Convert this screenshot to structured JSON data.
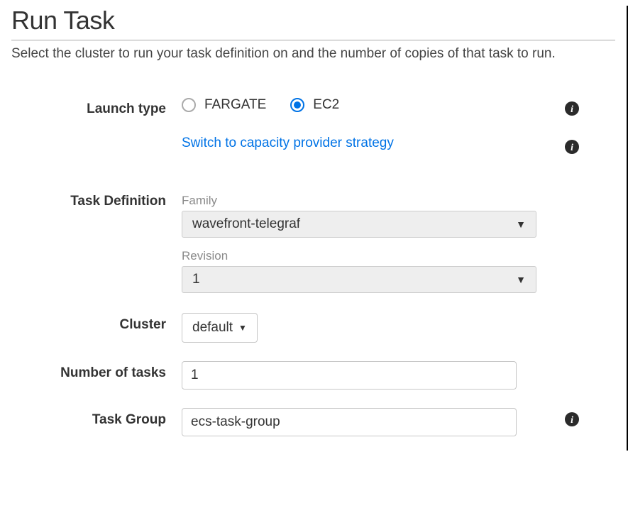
{
  "header": {
    "title": "Run Task",
    "subtitle": "Select the cluster to run your task definition on and the number of copies of that task to run."
  },
  "form": {
    "launch_type": {
      "label": "Launch type",
      "options": {
        "fargate": "FARGATE",
        "ec2": "EC2"
      },
      "selected": "EC2"
    },
    "capacity_link": "Switch to capacity provider strategy",
    "task_definition": {
      "label": "Task Definition",
      "family_label": "Family",
      "family_value": "wavefront-telegraf",
      "revision_label": "Revision",
      "revision_value": "1"
    },
    "cluster": {
      "label": "Cluster",
      "value": "default"
    },
    "number_of_tasks": {
      "label": "Number of tasks",
      "value": "1"
    },
    "task_group": {
      "label": "Task Group",
      "value": "ecs-task-group"
    }
  }
}
